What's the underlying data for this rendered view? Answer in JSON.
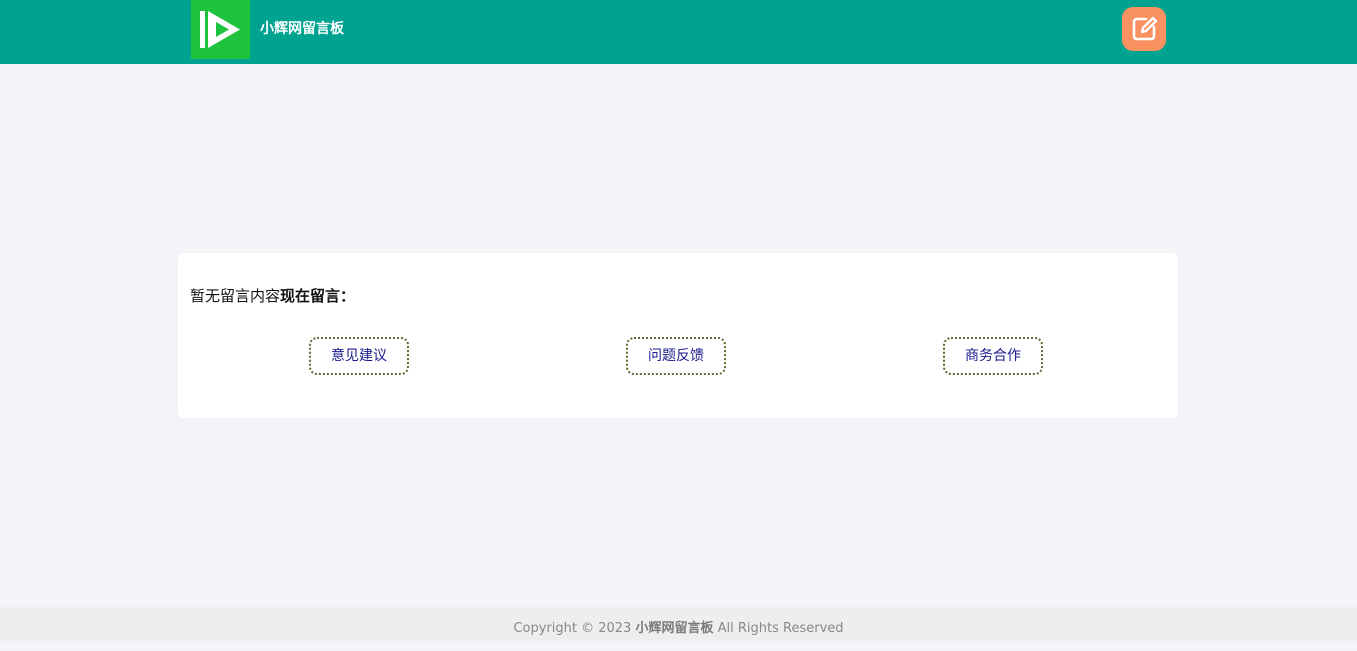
{
  "header": {
    "site_title": "小辉网留言板",
    "logo_icon": "play-logo-icon",
    "write_icon": "edit-icon",
    "colors": {
      "bar": "#00a290",
      "logo": "#1ec23c",
      "write_button": "#fa9160"
    }
  },
  "main": {
    "empty_text": "暂无留言内容",
    "cta_text": "现在留言：",
    "categories": [
      {
        "label": "意见建议"
      },
      {
        "label": "问题反馈"
      },
      {
        "label": "商务合作"
      }
    ]
  },
  "footer": {
    "prefix": "Copyright © 2023",
    "brand": "小辉网留言板",
    "suffix": "All Rights Reserved"
  }
}
